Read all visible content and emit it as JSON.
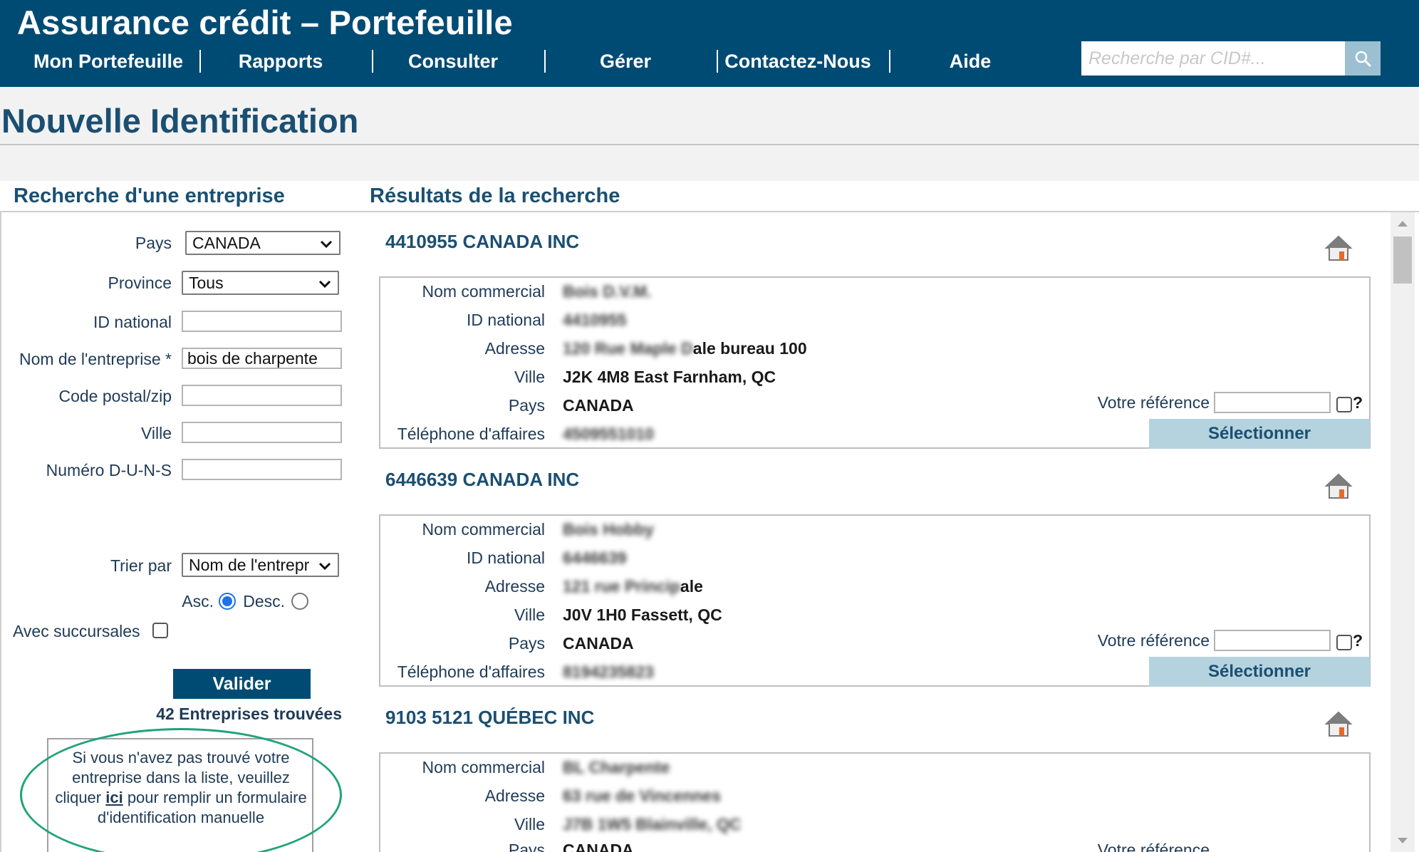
{
  "header": {
    "app_title": "Assurance crédit – Portefeuille",
    "search_placeholder": "Recherche par CID#...",
    "nav": [
      "Mon Portefeuille",
      "Rapports",
      "Consulter",
      "Gérer",
      "Contactez-Nous",
      "Aide"
    ]
  },
  "page_title": "Nouvelle Identification",
  "left_panel": {
    "heading": "Recherche d'une entreprise",
    "pays_label": "Pays",
    "pays_value": "CANADA",
    "province_label": "Province",
    "province_value": "Tous",
    "id_national_label": "ID national",
    "id_national_value": "",
    "nom_label": "Nom de l'entreprise *",
    "nom_value": "bois de charpente",
    "code_postal_label": "Code postal/zip",
    "code_postal_value": "",
    "ville_label": "Ville",
    "ville_value": "",
    "duns_label": "Numéro D-U-N-S",
    "duns_value": "",
    "trier_label": "Trier par",
    "trier_value": "Nom de l'entrepr",
    "asc_label": "Asc.",
    "desc_label": "Desc.",
    "sort_order": "asc",
    "succursales_label": "Avec succursales",
    "succursales_checked": false,
    "validate_label": "Valider",
    "found_count": "42 Entreprises trouvées",
    "manual_before": "Si vous n'avez pas trouvé votre entreprise dans la liste, veuillez cliquer ",
    "manual_link": "ici",
    "manual_after": " pour remplir un formulaire d'identification manuelle"
  },
  "results": {
    "heading": "Résultats de la recherche",
    "labels": {
      "nom_commercial": "Nom commercial",
      "id_national": "ID national",
      "adresse": "Adresse",
      "ville": "Ville",
      "pays": "Pays",
      "telephone": "Téléphone d'affaires",
      "reference": "Votre référence",
      "question_mark": "?",
      "select": "Sélectionner"
    },
    "items": [
      {
        "company": "4410955 CANADA INC",
        "nom_commercial": "Bois D.V.M.",
        "id_national": "4410955",
        "adresse_blur": "120 Rue Maple D",
        "adresse_clear": "ale bureau 100",
        "ville": "J2K 4M8 East Farnham, QC",
        "pays": "CANADA",
        "telephone": "4509551010"
      },
      {
        "company": "6446639 CANADA INC",
        "nom_commercial": "Bois Hobby",
        "id_national": "6446639",
        "adresse_blur": "121 rue Princip",
        "adresse_clear": "ale",
        "ville": "J0V 1H0 Fassett, QC",
        "pays": "CANADA",
        "telephone": "8194235823"
      },
      {
        "company": "9103 5121 QUÉBEC INC",
        "nom_commercial": "BL Charpente",
        "adresse_blur": "63 rue de Vincennes",
        "ville_blur": "J7B 1W5 Blainville, QC",
        "pays": "CANADA"
      }
    ]
  }
}
